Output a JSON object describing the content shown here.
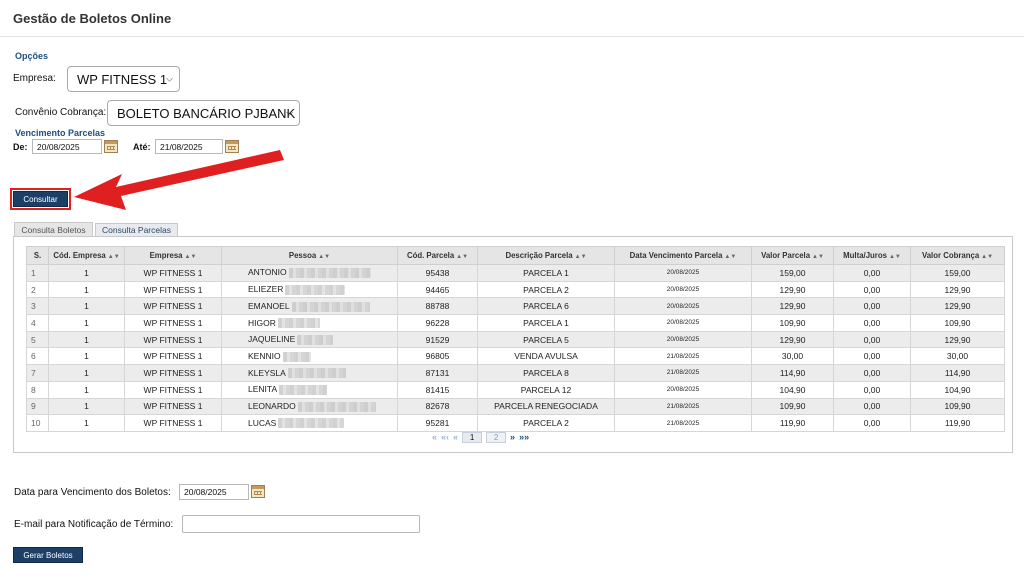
{
  "header": {
    "title": "Gestão de Boletos Online"
  },
  "options": {
    "section_label": "Opções",
    "empresa_label": "Empresa:",
    "empresa_value": "WP FITNESS 1",
    "convenio_label": "Convênio Cobrança:",
    "convenio_value": "BOLETO BANCÁRIO PJBANK",
    "vencimento_label": "Vencimento Parcelas",
    "de_label": "De:",
    "de_value": "20/08/2025",
    "ate_label": "Até:",
    "ate_value": "21/08/2025",
    "consultar_label": "Consultar"
  },
  "tabs": [
    {
      "label": "Consulta Boletos",
      "active": true
    },
    {
      "label": "Consulta Parcelas",
      "active": false
    }
  ],
  "table": {
    "columns": [
      "S.",
      "Cód. Empresa",
      "Empresa",
      "Pessoa",
      "Cód. Parcela",
      "Descrição Parcela",
      "Data Vencimento Parcela",
      "Valor Parcela",
      "Multa/Juros",
      "Valor Cobrança"
    ],
    "rows": [
      [
        "1",
        "1",
        "WP FITNESS 1",
        "ANTONIO",
        "95438",
        "PARCELA 1",
        "20/08/2025",
        "159,00",
        "0,00",
        "159,00"
      ],
      [
        "2",
        "1",
        "WP FITNESS 1",
        "ELIEZER",
        "94465",
        "PARCELA 2",
        "20/08/2025",
        "129,90",
        "0,00",
        "129,90"
      ],
      [
        "3",
        "1",
        "WP FITNESS 1",
        "EMANOEL",
        "88788",
        "PARCELA 6",
        "20/08/2025",
        "129,90",
        "0,00",
        "129,90"
      ],
      [
        "4",
        "1",
        "WP FITNESS 1",
        "HIGOR",
        "96228",
        "PARCELA 1",
        "20/08/2025",
        "109,90",
        "0,00",
        "109,90"
      ],
      [
        "5",
        "1",
        "WP FITNESS 1",
        "JAQUELINE",
        "91529",
        "PARCELA 5",
        "20/08/2025",
        "129,90",
        "0,00",
        "129,90"
      ],
      [
        "6",
        "1",
        "WP FITNESS 1",
        "KENNIO",
        "96805",
        "VENDA AVULSA",
        "21/08/2025",
        "30,00",
        "0,00",
        "30,00"
      ],
      [
        "7",
        "1",
        "WP FITNESS 1",
        "KLEYSLA",
        "87131",
        "PARCELA 8",
        "21/08/2025",
        "114,90",
        "0,00",
        "114,90"
      ],
      [
        "8",
        "1",
        "WP FITNESS 1",
        "LENITA",
        "81415",
        "PARCELA 12",
        "20/08/2025",
        "104,90",
        "0,00",
        "104,90"
      ],
      [
        "9",
        "1",
        "WP FITNESS 1",
        "LEONARDO",
        "82678",
        "PARCELA RENEGOCIADA",
        "21/08/2025",
        "109,90",
        "0,00",
        "109,90"
      ],
      [
        "10",
        "1",
        "WP FITNESS 1",
        "LUCAS",
        "95281",
        "PARCELA 2",
        "21/08/2025",
        "119,90",
        "0,00",
        "119,90"
      ]
    ]
  },
  "pager": {
    "first": "«",
    "prev_block": "«‹",
    "prev": "«",
    "current_page": "1",
    "next_page": "2",
    "next": "»",
    "last": "»»"
  },
  "footer": {
    "vencimento_boletos_label": "Data para Vencimento dos Boletos:",
    "vencimento_boletos_value": "20/08/2025",
    "email_label": "E-mail para Notificação de Término:",
    "email_value": "",
    "gerar_label": "Gerar Boletos"
  },
  "colors": {
    "accent": "#1b3f66",
    "section_label": "#1d4f80",
    "annotation_arrow": "#e02020"
  }
}
